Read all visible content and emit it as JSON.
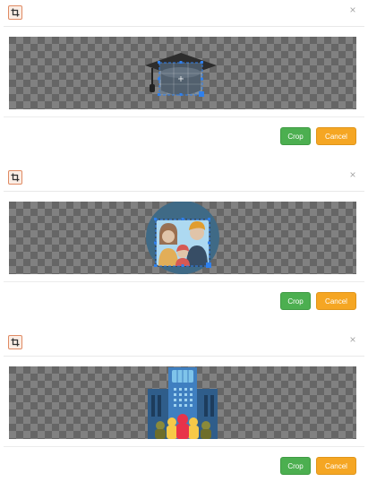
{
  "dialogs": [
    {
      "crop_label": "Crop",
      "cancel_label": "Cancel",
      "close_glyph": "×",
      "image": "graduation-cap-icon",
      "header_icon": "crop-icon"
    },
    {
      "crop_label": "Crop",
      "cancel_label": "Cancel",
      "close_glyph": "×",
      "image": "family-photo-icon",
      "header_icon": "crop-icon"
    },
    {
      "crop_label": "Crop",
      "cancel_label": "Cancel",
      "close_glyph": "×",
      "image": "school-building-icon",
      "header_icon": "crop-icon"
    }
  ],
  "colors": {
    "crop_button": "#4caf50",
    "cancel_button": "#f5a623",
    "crop_handle": "#2f80ed",
    "crop_icon_border": "#e08a63"
  }
}
